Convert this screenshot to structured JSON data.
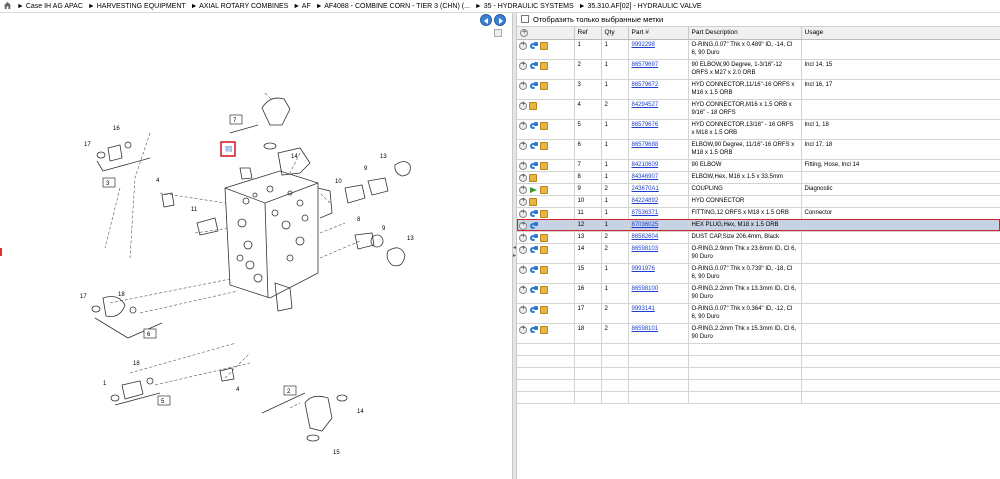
{
  "breadcrumb": {
    "items": [
      "Case IH AG APAC",
      "HARVESTING EQUIPMENT",
      "AXIAL ROTARY COMBINES",
      "AF",
      "AF4088 - COMBINE CORN - TIER 3 (CHN) (...",
      "35 - HYDRAULIC SYSTEMS",
      "35.310.AF[02] - HYDRAULIC VALVE"
    ]
  },
  "right_panel": {
    "show_selected_label": "Отобразить только выбранные метки"
  },
  "table": {
    "headers": [
      "",
      "Ref",
      "Qty",
      "Part #",
      "Part Description",
      "Usage"
    ],
    "rows": [
      {
        "ref": "1",
        "qty": "1",
        "part": "9992298",
        "desc": "O-RING,0.07\" Thk x 0.489\" ID, -14, Cl 6, 90 Duro",
        "usage": "",
        "icons": "info-box",
        "sel": false
      },
      {
        "ref": "2",
        "qty": "1",
        "part": "86579697",
        "desc": "90 ELBOW,90 Degree, 1-3/16\"-12 ORFS x M27 x 2.0 ORB",
        "usage": "Incl 14, 15",
        "icons": "info-box",
        "sel": false
      },
      {
        "ref": "3",
        "qty": "1",
        "part": "86579672",
        "desc": "HYD CONNECTOR,11/16\"-16 ORFS x M16 x 1.5 ORB",
        "usage": "Incl 16, 17",
        "icons": "info-box",
        "sel": false
      },
      {
        "ref": "4",
        "qty": "2",
        "part": "84294527",
        "desc": "HYD CONNECTOR,M16 x 1.5 ORB x 9/16\" - 18 ORFS",
        "usage": "",
        "icons": "box",
        "sel": false
      },
      {
        "ref": "5",
        "qty": "1",
        "part": "86579676",
        "desc": "HYD CONNECTOR,13/16\" - 16 ORFS x M18 x 1.5 ORB",
        "usage": "Incl 1, 18",
        "icons": "info-box",
        "sel": false
      },
      {
        "ref": "6",
        "qty": "1",
        "part": "86579688",
        "desc": "ELBOW,90 Degree, 11/16\"-16 ORFS x M18 x 1.5 ORB",
        "usage": "Incl 17, 18",
        "icons": "info-box",
        "sel": false
      },
      {
        "ref": "7",
        "qty": "1",
        "part": "84210609",
        "desc": "90 ELBOW",
        "usage": "Fitting, Hose, Incl 14",
        "icons": "info-box",
        "sel": false
      },
      {
        "ref": "8",
        "qty": "1",
        "part": "84346907",
        "desc": "ELBOW,Hex, M16 x 1.5 x 33.5mm",
        "usage": "",
        "icons": "box",
        "sel": false
      },
      {
        "ref": "9",
        "qty": "2",
        "part": "243670A1",
        "desc": "COUPLING",
        "usage": "Diagnostic",
        "icons": "green",
        "sel": false
      },
      {
        "ref": "10",
        "qty": "1",
        "part": "84224892",
        "desc": "HYD CONNECTOR",
        "usage": "",
        "icons": "box",
        "sel": false
      },
      {
        "ref": "11",
        "qty": "1",
        "part": "87536371",
        "desc": "FITTING,12 ORFS x M18 x 1.5 ORB",
        "usage": "Connector",
        "icons": "info-box",
        "sel": false
      },
      {
        "ref": "12",
        "qty": "1",
        "part": "87036025",
        "desc": "HEX PLUG,Hex, M18 x 1.5 ORB",
        "usage": "",
        "icons": "info",
        "sel": true
      },
      {
        "ref": "13",
        "qty": "2",
        "part": "86582604",
        "desc": "DUST CAP,Size 206.4mm, Black",
        "usage": "",
        "icons": "info-box",
        "sel": false
      },
      {
        "ref": "14",
        "qty": "2",
        "part": "86598103",
        "desc": "O-RING,2.9mm Thk x 23.6mm ID, Cl 6, 90 Duro",
        "usage": "",
        "icons": "info-box",
        "sel": false
      },
      {
        "ref": "15",
        "qty": "1",
        "part": "9991976",
        "desc": "O-RING,0.07\" Thk x 0.739\" ID, -18, Cl 6, 90 Duro",
        "usage": "",
        "icons": "info-box",
        "sel": false
      },
      {
        "ref": "16",
        "qty": "1",
        "part": "86598100",
        "desc": "O-RING,2.2mm Thk x 13.3mm ID, Cl 6, 90 Duro",
        "usage": "",
        "icons": "info-box",
        "sel": false
      },
      {
        "ref": "17",
        "qty": "2",
        "part": "9993141",
        "desc": "O-RING,0.07\" Thk x 0.364\" ID, -12, Cl 6, 90 Duro",
        "usage": "",
        "icons": "info-box",
        "sel": false
      },
      {
        "ref": "18",
        "qty": "2",
        "part": "86598101",
        "desc": "O-RING,2.2mm Thk x 15.3mm ID, Cl 6, 90 Duro",
        "usage": "",
        "icons": "info-box",
        "sel": false
      }
    ]
  },
  "diagram": {
    "callouts": [
      "1",
      "2",
      "3",
      "4",
      "4",
      "5",
      "6",
      "7",
      "8",
      "9",
      "9",
      "10",
      "11",
      "12",
      "13",
      "13",
      "14",
      "14",
      "15",
      "16",
      "17",
      "17",
      "18",
      "18"
    ],
    "highlighted_ref": "12",
    "highlight_color": "#d3242b"
  }
}
